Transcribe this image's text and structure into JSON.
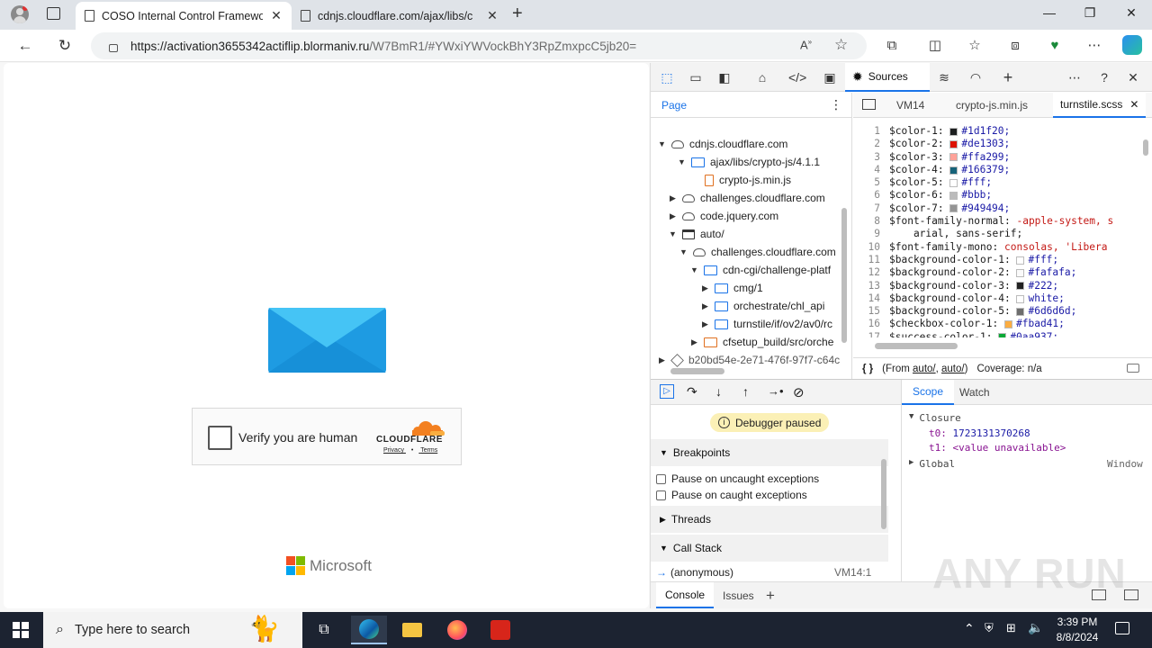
{
  "browser": {
    "tabs": [
      {
        "title": "COSO Internal Control Framewor",
        "active": true
      },
      {
        "title": "cdnjs.cloudflare.com/ajax/libs/c",
        "active": false
      }
    ],
    "url_host": "https://activation3655342actiflip.blormaniv.ru",
    "url_path": "/W7BmR1/#YWxiYWVockBhY3RpZmxpcC5jb20="
  },
  "page": {
    "captcha_label": "Verify you are human",
    "cloudflare_brand": "CLOUDFLARE",
    "privacy_link": "Privacy",
    "terms_link": "Terms",
    "link_separator": "•",
    "microsoft_brand": "Microsoft"
  },
  "devtools": {
    "sources_tab": "Sources",
    "navigator_tab": "Page",
    "tree": [
      {
        "label": "cdnjs.cloudflare.com",
        "icon": "cloud",
        "expanded": true
      },
      {
        "label": "ajax/libs/crypto-js/4.1.1",
        "icon": "folder",
        "expanded": true
      },
      {
        "label": "crypto-js.min.js",
        "icon": "file"
      },
      {
        "label": "challenges.cloudflare.com",
        "icon": "cloud",
        "expanded": false
      },
      {
        "label": "code.jquery.com",
        "icon": "cloud",
        "expanded": false
      },
      {
        "label": "auto/",
        "icon": "window",
        "expanded": true
      },
      {
        "label": "challenges.cloudflare.com",
        "icon": "cloud",
        "expanded": true
      },
      {
        "label": "cdn-cgi/challenge-platf",
        "icon": "folder",
        "expanded": true
      },
      {
        "label": "cmg/1",
        "icon": "folder",
        "expanded": false
      },
      {
        "label": "orchestrate/chl_api",
        "icon": "folder",
        "expanded": false
      },
      {
        "label": "turnstile/if/ov2/av0/rc",
        "icon": "folder",
        "expanded": false
      },
      {
        "label": "cfsetup_build/src/orche",
        "icon": "folder-orange",
        "expanded": false
      },
      {
        "label": "b20bd54e-2e71-476f-97f7-c64c",
        "icon": "cube",
        "expanded": false
      }
    ],
    "editor_tabs": [
      "VM14",
      "crypto-js.min.js",
      "turnstile.scss"
    ],
    "code_lines": [
      {
        "n": "1",
        "var": "$color-1:",
        "swatch": "#1d1f20",
        "val": "#1d1f20;"
      },
      {
        "n": "2",
        "var": "$color-2:",
        "swatch": "#de1303",
        "val": "#de1303;"
      },
      {
        "n": "3",
        "var": "$color-3:",
        "swatch": "#ffa299",
        "val": "#ffa299;"
      },
      {
        "n": "4",
        "var": "$color-4:",
        "swatch": "#166379",
        "val": "#166379;"
      },
      {
        "n": "5",
        "var": "$color-5:",
        "swatch": "#ffffff",
        "val": "#fff;"
      },
      {
        "n": "6",
        "var": "$color-6:",
        "swatch": "#bbbbbb",
        "val": "#bbb;"
      },
      {
        "n": "7",
        "var": "$color-7:",
        "swatch": "#949494",
        "val": "#949494;"
      },
      {
        "n": "8",
        "var": "$font-family-normal:",
        "swatch": "",
        "val": "-apple-system, s"
      },
      {
        "n": "9",
        "var": "    arial, sans-serif;",
        "swatch": "",
        "val": ""
      },
      {
        "n": "10",
        "var": "$font-family-mono:",
        "swatch": "",
        "val": "consolas, 'Libera"
      },
      {
        "n": "11",
        "var": "$background-color-1:",
        "swatch": "#ffffff",
        "val": "#fff;"
      },
      {
        "n": "12",
        "var": "$background-color-2:",
        "swatch": "#fafafa",
        "val": "#fafafa;"
      },
      {
        "n": "13",
        "var": "$background-color-3:",
        "swatch": "#222222",
        "val": "#222;"
      },
      {
        "n": "14",
        "var": "$background-color-4:",
        "swatch": "#ffffff",
        "val": "white;"
      },
      {
        "n": "15",
        "var": "$background-color-5:",
        "swatch": "#6d6d6d",
        "val": "#6d6d6d;"
      },
      {
        "n": "16",
        "var": "$checkbox-color-1:",
        "swatch": "#fbad41",
        "val": "#fbad41;"
      },
      {
        "n": "17",
        "var": "$success-color-1:",
        "swatch": "#0aa937",
        "val": "#0aa937;"
      }
    ],
    "status": {
      "from_prefix": "(From",
      "from_link1": "auto/",
      "sep": ",",
      "from_link2": "auto/",
      "close": ")",
      "coverage": "Coverage: n/a"
    },
    "debugger": {
      "paused": "Debugger paused",
      "breakpoints": "Breakpoints",
      "pause_uncaught": "Pause on uncaught exceptions",
      "pause_caught": "Pause on caught exceptions",
      "threads": "Threads",
      "call_stack": "Call Stack",
      "frame_name": "(anonymous)",
      "frame_loc": "VM14:1"
    },
    "scope": {
      "tabs": [
        "Scope",
        "Watch"
      ],
      "closure": "Closure",
      "t0_key": "t0:",
      "t0_val": "1723131370268",
      "t1_key": "t1:",
      "t1_val": "<value unavailable>",
      "global": "Global",
      "global_val": "Window"
    },
    "drawer_tabs": [
      "Console",
      "Issues"
    ]
  },
  "taskbar": {
    "search_placeholder": "Type here to search",
    "time": "3:39 PM",
    "date": "8/8/2024"
  },
  "watermark": "ANY RUN",
  "colors": {
    "accent": "#1a73e8",
    "taskbar": "#1c2331",
    "paused_badge": "#fbf0b6"
  }
}
